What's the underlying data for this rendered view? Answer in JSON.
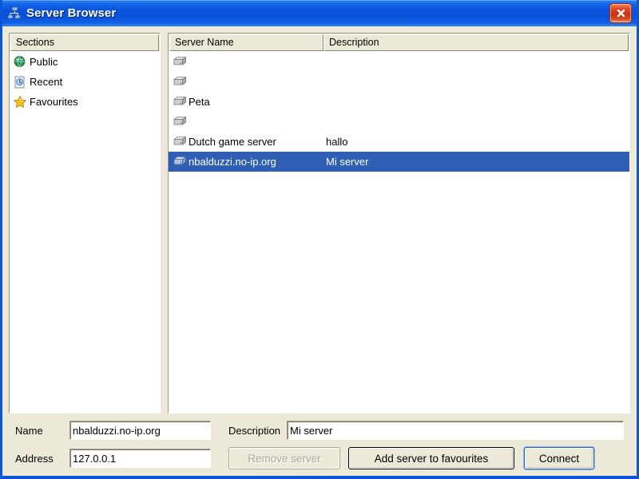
{
  "window": {
    "title": "Server Browser",
    "title_icon": "network-servers-icon",
    "close_label": "✕",
    "titlebar_color": "#0a53dd",
    "face_color": "#ece9d8",
    "selection_color": "#2f5fb5"
  },
  "sections_pane": {
    "header": "Sections",
    "items": [
      {
        "label": "Public",
        "icon": "globe-icon"
      },
      {
        "label": "Recent",
        "icon": "recent-page-icon"
      },
      {
        "label": "Favourites",
        "icon": "star-icon"
      }
    ]
  },
  "servers_pane": {
    "columns": [
      "Server Name",
      "Description"
    ],
    "rows": [
      {
        "name": "",
        "description": "",
        "icon": "server-icon",
        "selected": false
      },
      {
        "name": "",
        "description": "",
        "icon": "server-icon",
        "selected": false
      },
      {
        "name": "Peta",
        "description": "",
        "icon": "server-icon",
        "selected": false
      },
      {
        "name": "",
        "description": "",
        "icon": "server-icon",
        "selected": false
      },
      {
        "name": "Dutch game server",
        "description": "hallo",
        "icon": "server-icon",
        "selected": false
      },
      {
        "name": "nbalduzzi.no-ip.org",
        "description": "Mi server",
        "icon": "server-icon",
        "selected": true
      }
    ]
  },
  "form": {
    "name_label": "Name",
    "name_value": "nbalduzzi.no-ip.org",
    "address_label": "Address",
    "address_value": "127.0.0.1",
    "description_label": "Description",
    "description_value": "Mi server"
  },
  "buttons": {
    "remove": "Remove server",
    "remove_disabled": true,
    "add_favourites": "Add server to favourites",
    "connect": "Connect",
    "connect_is_default": true
  }
}
